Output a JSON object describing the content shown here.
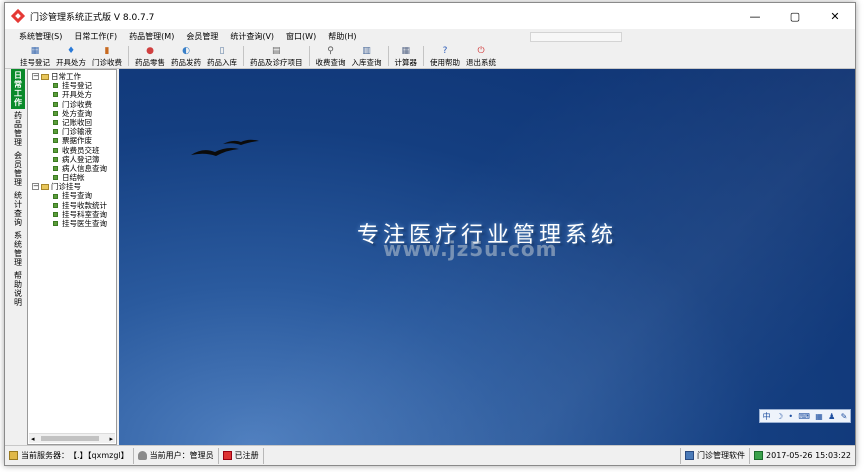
{
  "window": {
    "title": "门诊管理系统正式版 V 8.0.7.7",
    "controls": {
      "minimize": "—",
      "maximize": "▢",
      "close": "✕"
    }
  },
  "menu": [
    "系统管理(S)",
    "日常工作(F)",
    "药品管理(M)",
    "会员管理",
    "统计查询(V)",
    "窗口(W)",
    "帮助(H)"
  ],
  "toolbar": [
    {
      "label": "挂号登记",
      "icon": "register-icon",
      "glyph": "▦",
      "color": "#3a6ab0"
    },
    {
      "label": "开具处方",
      "icon": "prescription-icon",
      "glyph": "♦",
      "color": "#2a7ad8"
    },
    {
      "label": "门诊收费",
      "icon": "fee-icon",
      "glyph": "▮",
      "color": "#c86a20"
    },
    {
      "label": "药品零售",
      "icon": "retail-icon",
      "glyph": "●",
      "color": "#d04040"
    },
    {
      "label": "药品发药",
      "icon": "dispense-icon",
      "glyph": "◐",
      "color": "#3a80c8"
    },
    {
      "label": "药品入库",
      "icon": "stockin-icon",
      "glyph": "▯",
      "color": "#5a7aa0"
    },
    {
      "label": "药品及诊疗项目",
      "icon": "items-icon",
      "glyph": "▤",
      "color": "#6a6a6a"
    },
    {
      "label": "收费查询",
      "icon": "fee-query-icon",
      "glyph": "⚲",
      "color": "#5a5a5a"
    },
    {
      "label": "入库查询",
      "icon": "stock-query-icon",
      "glyph": "▥",
      "color": "#4a6a9a"
    },
    {
      "label": "计算器",
      "icon": "calculator-icon",
      "glyph": "▦",
      "color": "#5a6a8a"
    },
    {
      "label": "使用帮助",
      "icon": "help-icon",
      "glyph": "?",
      "color": "#2a5ab8"
    },
    {
      "label": "退出系统",
      "icon": "exit-icon",
      "glyph": "⏻",
      "color": "#d03030"
    }
  ],
  "vtabs": [
    {
      "label": "日常工作",
      "active": true
    },
    {
      "label": "药品管理",
      "active": false
    },
    {
      "label": "会员管理",
      "active": false
    },
    {
      "label": "统计查询",
      "active": false
    },
    {
      "label": "系统管理",
      "active": false
    },
    {
      "label": "帮助说明",
      "active": false
    }
  ],
  "tree": [
    {
      "label": "日常工作",
      "expander": "−",
      "children": [
        "挂号登记",
        "开具处方",
        "门诊收费",
        "处方查询",
        "记账收回",
        "门诊输液",
        "票据作废",
        "收费员交班",
        "病人登记簿",
        "病人信息查询",
        "日结帐"
      ]
    },
    {
      "label": "门诊挂号",
      "expander": "−",
      "children": [
        "挂号查询",
        "挂号收款统计",
        "挂号科室查询",
        "挂号医生查询"
      ]
    }
  ],
  "main": {
    "banner": "专注医疗行业管理系统",
    "watermark": "www.jz5u.com",
    "ime": [
      "中",
      "☽",
      "•",
      "⌨",
      "▦",
      "♟",
      "✎"
    ]
  },
  "status": {
    "server_label": "当前服务器：",
    "server_value": "【.】【qxmzgl】",
    "user_label": "当前用户：",
    "user_value": "管理员",
    "registered": "已注册",
    "software": "门诊管理软件",
    "datetime": "2017-05-26 15:03:22"
  }
}
